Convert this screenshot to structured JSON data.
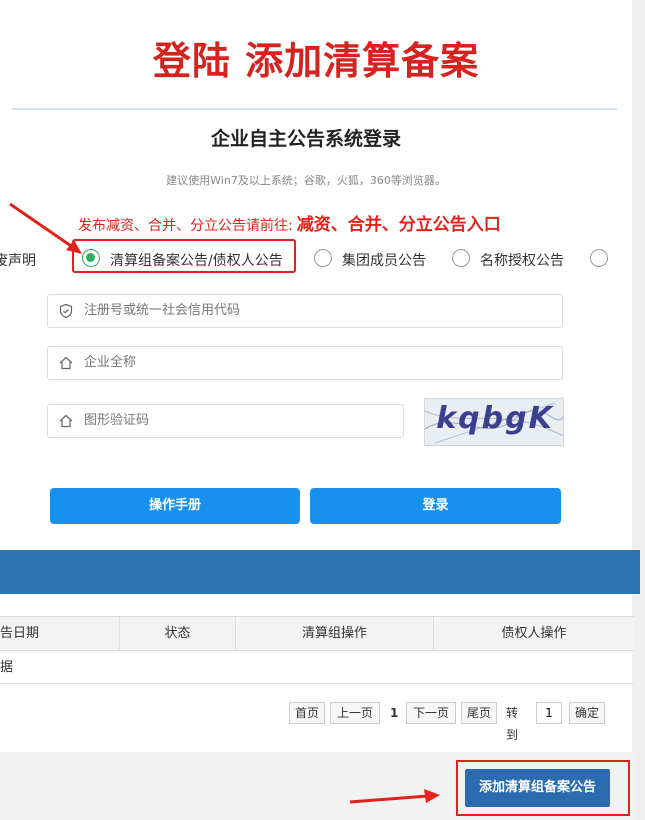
{
  "banner": {
    "title": "登陆  添加清算备案"
  },
  "login": {
    "title": "企业自主公告系统登录",
    "browser_tip": "建议使用Win7及以上系统；谷歌，火狐，360等浏览器。",
    "notice_prefix": "发布减资、合并、分立公告请前往:",
    "notice_link": "减资、合并、分立公告入口"
  },
  "notice_types": {
    "cut_label": "作废声明",
    "options": [
      {
        "label": "清算组备案公告/债权人公告",
        "selected": true
      },
      {
        "label": "集团成员公告",
        "selected": false
      },
      {
        "label": "名称授权公告",
        "selected": false
      }
    ]
  },
  "form": {
    "reg_code_placeholder": "注册号或统一社会信用代码",
    "company_name_placeholder": "企业全称",
    "captcha_placeholder": "图形验证码",
    "captcha_text": "kqbgK",
    "manual_button": "操作手册",
    "login_button": "登录"
  },
  "table": {
    "columns": [
      "告日期",
      "状态",
      "清算组操作",
      "债权人操作"
    ],
    "empty_text": "据"
  },
  "pagination": {
    "first": "首页",
    "prev": "上一页",
    "current": "1",
    "next": "下一页",
    "last": "尾页",
    "goto_label": "转到",
    "goto_value": "1",
    "confirm": "确定"
  },
  "footer": {
    "add_button": "添加清算组备案公告"
  },
  "colors": {
    "accent_red": "#e0241c",
    "primary_blue": "#1890ee",
    "band_blue": "#2b75b5",
    "radio_green": "#2eae5a"
  }
}
